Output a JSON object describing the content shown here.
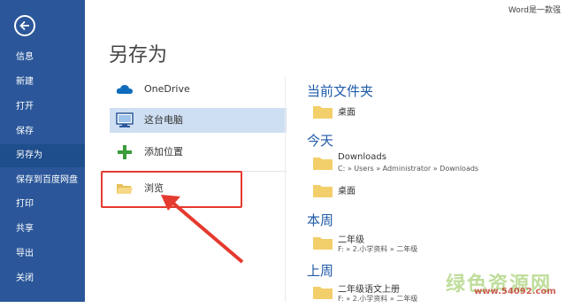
{
  "window": {
    "title": "Word是一款强"
  },
  "sidebar": {
    "items": [
      {
        "label": "信息"
      },
      {
        "label": "新建"
      },
      {
        "label": "打开"
      },
      {
        "label": "保存"
      },
      {
        "label": "另存为"
      },
      {
        "label": "保存到百度网盘"
      },
      {
        "label": "打印"
      },
      {
        "label": "共享"
      },
      {
        "label": "导出"
      },
      {
        "label": "关闭"
      }
    ],
    "active_index": 4
  },
  "page": {
    "title": "另存为"
  },
  "locations": [
    {
      "label": "OneDrive",
      "icon": "cloud-icon"
    },
    {
      "label": "这台电脑",
      "icon": "computer-icon",
      "selected": true
    },
    {
      "label": "添加位置",
      "icon": "plus-icon"
    },
    {
      "label": "浏览",
      "icon": "folder-open-icon"
    }
  ],
  "recent": {
    "current_folder": {
      "heading": "当前文件夹",
      "items": [
        {
          "name": "桌面"
        }
      ]
    },
    "today": {
      "heading": "今天",
      "items": [
        {
          "name": "Downloads",
          "path": "C: » Users » Administrator » Downloads"
        },
        {
          "name": "桌面"
        }
      ]
    },
    "this_week": {
      "heading": "本周",
      "items": [
        {
          "name": "二年级",
          "path": "F: » 2.小学资料 » 二年级"
        }
      ]
    },
    "last_week": {
      "heading": "上周",
      "items": [
        {
          "name": "二年级语文上册",
          "path": "F: » 2.小学资料 » 二年级"
        }
      ]
    }
  },
  "watermark": {
    "main": "绿色资源网",
    "url": "www.54092.com"
  },
  "colors": {
    "sidebar": "#2b579a",
    "accent": "#1f5aa8",
    "highlight": "#e53a2f",
    "selected": "#cfdff3"
  }
}
